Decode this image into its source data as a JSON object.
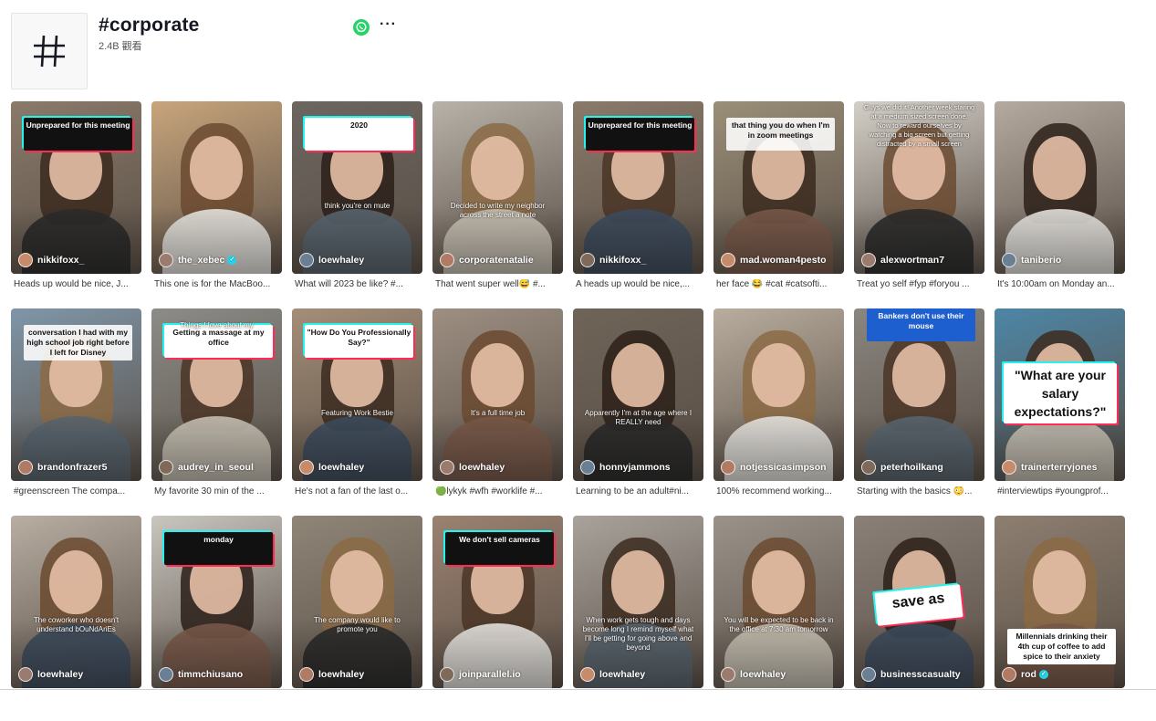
{
  "header": {
    "title": "#corporate",
    "views": "2.4B 觀看",
    "hashtag_symbol": "#",
    "icons": [
      "hashtag-icon",
      "whatsapp-icon",
      "more-icon"
    ],
    "more_glyph": "···"
  },
  "colors": {
    "tiktok_red": "#fe2c55",
    "tiktok_cyan": "#25f4ee",
    "whatsapp_green": "#25d366",
    "verified_blue": "#20d5ec"
  },
  "videos": [
    {
      "author": "nikkifoxx_",
      "desc": "Heads up would be nice, J...",
      "caption": "Unprepared for this meeting",
      "caption_style": "dark",
      "overlay": "",
      "bg": "#8a7a6a",
      "verified": false
    },
    {
      "author": "the_xebec",
      "desc": "This one is for the MacBoo...",
      "caption": "",
      "caption_style": "",
      "overlay": "",
      "bg": "#c8a57c",
      "verified": true
    },
    {
      "author": "loewhaley",
      "desc": "What will 2023 be like? #...",
      "caption": "2020",
      "caption_style": "light",
      "overlay": "think you're on mute",
      "bg": "#6c6660",
      "verified": false
    },
    {
      "author": "corporatenatalie",
      "desc": "That went super well😅 #...",
      "caption": "",
      "caption_style": "",
      "overlay": "Decided to write my neighbor across the street a note",
      "bg": "#b8b2a8",
      "verified": false
    },
    {
      "author": "nikkifoxx_",
      "desc": "A heads up would be nice,...",
      "caption": "Unprepared for this meeting",
      "caption_style": "dark",
      "overlay": "",
      "bg": "#8a7a6a",
      "verified": false
    },
    {
      "author": "mad.woman4pesto",
      "desc": "her face 😂 #cat #catsofti...",
      "caption": "that thing you do when I'm in zoom meetings",
      "caption_style": "plain",
      "overlay": "",
      "bg": "#9a8f78",
      "verified": false
    },
    {
      "author": "alexwortman7",
      "desc": "Treat yo self #fyp #foryou ...",
      "caption": "",
      "caption_style": "",
      "overlay": "Guys we did it! Another week staring at a medium sized screen done. Now to reward ourselves by watching a big screen but getting distracted by a small screen",
      "bg": "#d3cfc7",
      "verified": false
    },
    {
      "author": "taniberio",
      "desc": "It's 10:00am on Monday an...",
      "caption": "",
      "caption_style": "",
      "overlay": "",
      "bg": "#b4aaa0",
      "verified": false
    },
    {
      "author": "brandonfrazer5",
      "desc": "#greenscreen The compa...",
      "caption": "conversation I had with my high school job right before I left for Disney",
      "caption_style": "plain",
      "overlay": "",
      "bg": "#7f96a8",
      "verified": false
    },
    {
      "author": "audrey_in_seoul",
      "desc": "My favorite 30 min of the ...",
      "caption": "Getting a massage at my office",
      "caption_style": "light",
      "overlay": "Things I love about my",
      "bg": "#8c8c88",
      "verified": false
    },
    {
      "author": "loewhaley",
      "desc": "He's not a fan of the last o...",
      "caption": "\"How Do You Professionally Say?\"",
      "caption_style": "light",
      "overlay": "Featuring Work Bestie",
      "bg": "#a48e78",
      "verified": false
    },
    {
      "author": "loewhaley",
      "desc": "🟢lykyk #wfh #worklife #...",
      "caption": "",
      "caption_style": "",
      "overlay": "It's a full time job",
      "bg": "#9d8f82",
      "verified": false
    },
    {
      "author": "honnyjammons",
      "desc": "Learning to be an adult#ni...",
      "caption": "",
      "caption_style": "",
      "overlay": "Apparently I'm at the age where I REALLY need",
      "bg": "#6f6458",
      "verified": false
    },
    {
      "author": "notjessicasimpson",
      "desc": "100% recommend working...",
      "caption": "",
      "caption_style": "",
      "overlay": "",
      "bg": "#b9ad9e",
      "verified": false
    },
    {
      "author": "peterhoilkang",
      "desc": "Starting with the basics 😳...",
      "caption": "Bankers don't use their mouse",
      "caption_style": "blue",
      "overlay": "",
      "bg": "#8a8680",
      "verified": false
    },
    {
      "author": "trainerterryjones",
      "desc": "#interviewtips #youngprof...",
      "caption": "\"What are your salary expectations?\"",
      "caption_style": "big",
      "overlay": "",
      "bg": "#4d86a6",
      "verified": false
    },
    {
      "author": "loewhaley",
      "desc": "",
      "caption": "",
      "caption_style": "",
      "overlay": "The coworker who doesn't understand bOuNdAriEs",
      "bg": "#b8aea2",
      "verified": false
    },
    {
      "author": "timmchiusano",
      "desc": "",
      "caption": "monday",
      "caption_style": "dark",
      "overlay": "",
      "bg": "#c9c6c0",
      "verified": false
    },
    {
      "author": "loewhaley",
      "desc": "",
      "caption": "",
      "caption_style": "",
      "overlay": "The company would like to promote you",
      "bg": "#8f8678",
      "verified": false
    },
    {
      "author": "joinparallel.io",
      "desc": "",
      "caption": "We don't sell cameras",
      "caption_style": "dark",
      "overlay": "",
      "bg": "#9b8271",
      "verified": false
    },
    {
      "author": "loewhaley",
      "desc": "",
      "caption": "",
      "caption_style": "",
      "overlay": "When work gets tough and days become long I remind myself what I'll be getting for going above and beyond",
      "bg": "#a9a39c",
      "verified": false
    },
    {
      "author": "loewhaley",
      "desc": "",
      "caption": "",
      "caption_style": "",
      "overlay": "You will be expected to be back in the office at 7:30 am tomorrow",
      "bg": "#9b938a",
      "verified": false
    },
    {
      "author": "businesscasualty",
      "desc": "",
      "caption": "save as",
      "caption_style": "save",
      "overlay": "",
      "bg": "#8b8078",
      "verified": false
    },
    {
      "author": "rod",
      "desc": "",
      "caption": "Millennials drinking their 4th cup of coffee to add spice to their anxiety",
      "caption_style": "light",
      "overlay": "",
      "bg": "#8d7f70",
      "verified": true
    }
  ]
}
